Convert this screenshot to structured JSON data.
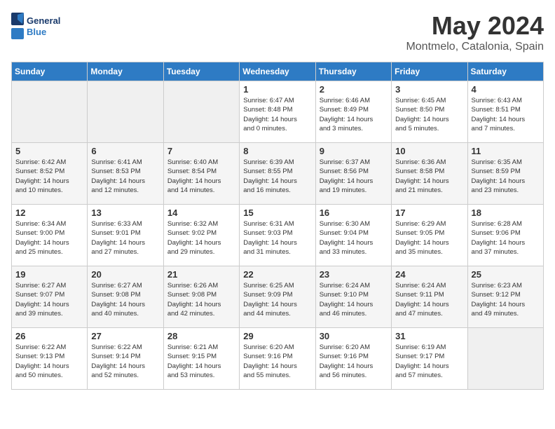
{
  "header": {
    "logo_general": "General",
    "logo_blue": "Blue",
    "month": "May 2024",
    "location": "Montmelo, Catalonia, Spain"
  },
  "columns": [
    "Sunday",
    "Monday",
    "Tuesday",
    "Wednesday",
    "Thursday",
    "Friday",
    "Saturday"
  ],
  "weeks": [
    [
      {
        "day": "",
        "info": ""
      },
      {
        "day": "",
        "info": ""
      },
      {
        "day": "",
        "info": ""
      },
      {
        "day": "1",
        "info": "Sunrise: 6:47 AM\nSunset: 8:48 PM\nDaylight: 14 hours\nand 0 minutes."
      },
      {
        "day": "2",
        "info": "Sunrise: 6:46 AM\nSunset: 8:49 PM\nDaylight: 14 hours\nand 3 minutes."
      },
      {
        "day": "3",
        "info": "Sunrise: 6:45 AM\nSunset: 8:50 PM\nDaylight: 14 hours\nand 5 minutes."
      },
      {
        "day": "4",
        "info": "Sunrise: 6:43 AM\nSunset: 8:51 PM\nDaylight: 14 hours\nand 7 minutes."
      }
    ],
    [
      {
        "day": "5",
        "info": "Sunrise: 6:42 AM\nSunset: 8:52 PM\nDaylight: 14 hours\nand 10 minutes."
      },
      {
        "day": "6",
        "info": "Sunrise: 6:41 AM\nSunset: 8:53 PM\nDaylight: 14 hours\nand 12 minutes."
      },
      {
        "day": "7",
        "info": "Sunrise: 6:40 AM\nSunset: 8:54 PM\nDaylight: 14 hours\nand 14 minutes."
      },
      {
        "day": "8",
        "info": "Sunrise: 6:39 AM\nSunset: 8:55 PM\nDaylight: 14 hours\nand 16 minutes."
      },
      {
        "day": "9",
        "info": "Sunrise: 6:37 AM\nSunset: 8:56 PM\nDaylight: 14 hours\nand 19 minutes."
      },
      {
        "day": "10",
        "info": "Sunrise: 6:36 AM\nSunset: 8:58 PM\nDaylight: 14 hours\nand 21 minutes."
      },
      {
        "day": "11",
        "info": "Sunrise: 6:35 AM\nSunset: 8:59 PM\nDaylight: 14 hours\nand 23 minutes."
      }
    ],
    [
      {
        "day": "12",
        "info": "Sunrise: 6:34 AM\nSunset: 9:00 PM\nDaylight: 14 hours\nand 25 minutes."
      },
      {
        "day": "13",
        "info": "Sunrise: 6:33 AM\nSunset: 9:01 PM\nDaylight: 14 hours\nand 27 minutes."
      },
      {
        "day": "14",
        "info": "Sunrise: 6:32 AM\nSunset: 9:02 PM\nDaylight: 14 hours\nand 29 minutes."
      },
      {
        "day": "15",
        "info": "Sunrise: 6:31 AM\nSunset: 9:03 PM\nDaylight: 14 hours\nand 31 minutes."
      },
      {
        "day": "16",
        "info": "Sunrise: 6:30 AM\nSunset: 9:04 PM\nDaylight: 14 hours\nand 33 minutes."
      },
      {
        "day": "17",
        "info": "Sunrise: 6:29 AM\nSunset: 9:05 PM\nDaylight: 14 hours\nand 35 minutes."
      },
      {
        "day": "18",
        "info": "Sunrise: 6:28 AM\nSunset: 9:06 PM\nDaylight: 14 hours\nand 37 minutes."
      }
    ],
    [
      {
        "day": "19",
        "info": "Sunrise: 6:27 AM\nSunset: 9:07 PM\nDaylight: 14 hours\nand 39 minutes."
      },
      {
        "day": "20",
        "info": "Sunrise: 6:27 AM\nSunset: 9:08 PM\nDaylight: 14 hours\nand 40 minutes."
      },
      {
        "day": "21",
        "info": "Sunrise: 6:26 AM\nSunset: 9:08 PM\nDaylight: 14 hours\nand 42 minutes."
      },
      {
        "day": "22",
        "info": "Sunrise: 6:25 AM\nSunset: 9:09 PM\nDaylight: 14 hours\nand 44 minutes."
      },
      {
        "day": "23",
        "info": "Sunrise: 6:24 AM\nSunset: 9:10 PM\nDaylight: 14 hours\nand 46 minutes."
      },
      {
        "day": "24",
        "info": "Sunrise: 6:24 AM\nSunset: 9:11 PM\nDaylight: 14 hours\nand 47 minutes."
      },
      {
        "day": "25",
        "info": "Sunrise: 6:23 AM\nSunset: 9:12 PM\nDaylight: 14 hours\nand 49 minutes."
      }
    ],
    [
      {
        "day": "26",
        "info": "Sunrise: 6:22 AM\nSunset: 9:13 PM\nDaylight: 14 hours\nand 50 minutes."
      },
      {
        "day": "27",
        "info": "Sunrise: 6:22 AM\nSunset: 9:14 PM\nDaylight: 14 hours\nand 52 minutes."
      },
      {
        "day": "28",
        "info": "Sunrise: 6:21 AM\nSunset: 9:15 PM\nDaylight: 14 hours\nand 53 minutes."
      },
      {
        "day": "29",
        "info": "Sunrise: 6:20 AM\nSunset: 9:16 PM\nDaylight: 14 hours\nand 55 minutes."
      },
      {
        "day": "30",
        "info": "Sunrise: 6:20 AM\nSunset: 9:16 PM\nDaylight: 14 hours\nand 56 minutes."
      },
      {
        "day": "31",
        "info": "Sunrise: 6:19 AM\nSunset: 9:17 PM\nDaylight: 14 hours\nand 57 minutes."
      },
      {
        "day": "",
        "info": ""
      }
    ]
  ]
}
